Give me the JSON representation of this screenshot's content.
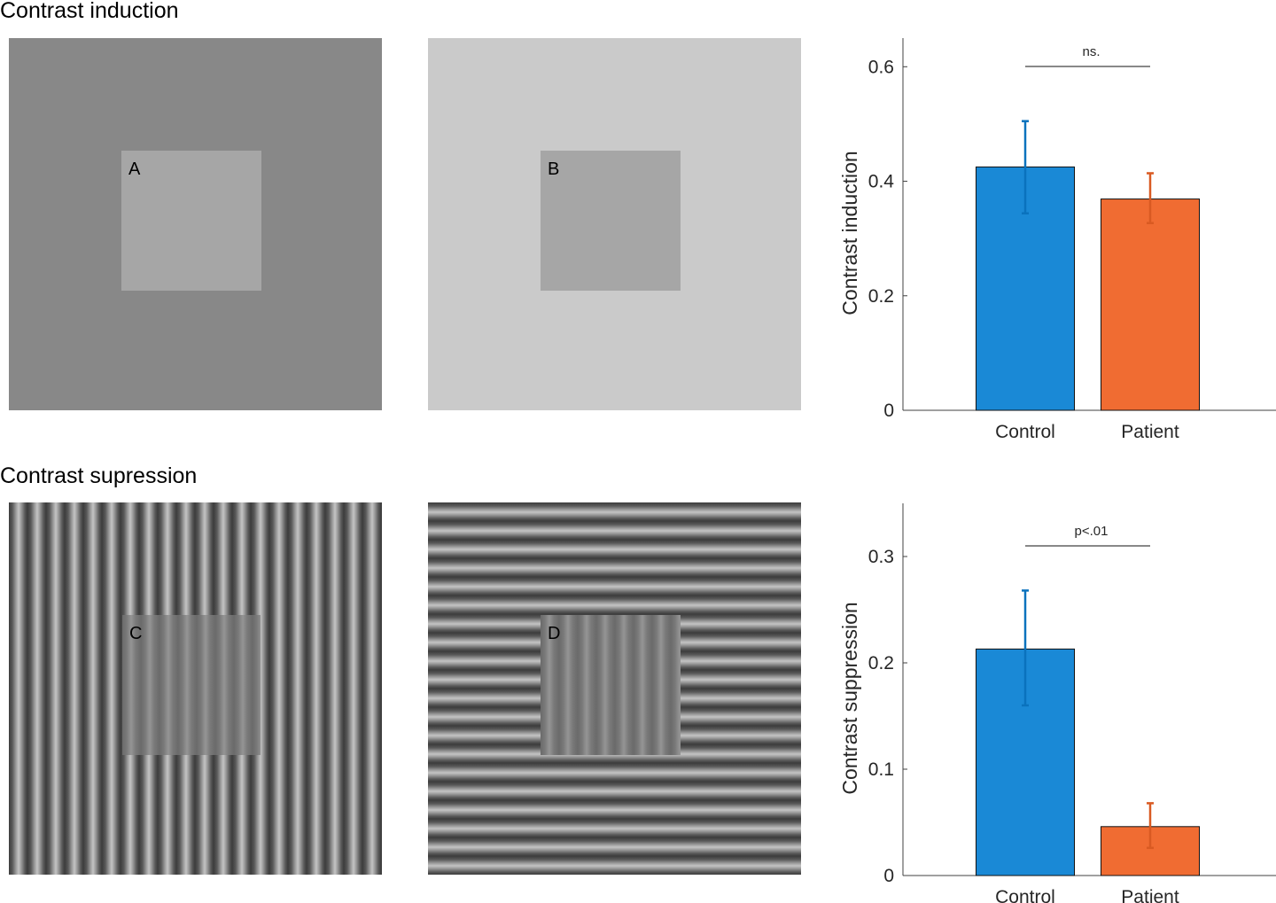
{
  "sections": {
    "induction_title": "Contrast induction",
    "suppression_title": "Contrast supression"
  },
  "stimuli": [
    {
      "label": "A",
      "type": "luminance",
      "surround": "#888888",
      "center": "#a6a6a6"
    },
    {
      "label": "B",
      "type": "luminance",
      "surround": "#cacaca",
      "center": "#a6a6a6"
    },
    {
      "label": "C",
      "type": "grating",
      "surround_orientation": "vertical",
      "center_orientation": "vertical",
      "center_contrast": "low"
    },
    {
      "label": "D",
      "type": "grating",
      "surround_orientation": "horizontal",
      "center_orientation": "vertical",
      "center_contrast": "low"
    }
  ],
  "colors": {
    "control": "#1a89d6",
    "patient": "#f06c32",
    "control_err": "#0a72bd",
    "patient_err": "#d95a22",
    "axis": "#404040"
  },
  "chart_data": [
    {
      "type": "bar",
      "title": "",
      "xlabel": "",
      "ylabel": "Contrast induction",
      "categories": [
        "Control",
        "Patient"
      ],
      "values": [
        0.425,
        0.369
      ],
      "error_low": [
        0.344,
        0.327
      ],
      "error_high": [
        0.505,
        0.414
      ],
      "ylim": [
        0,
        0.65
      ],
      "yticks": [
        0,
        0.2,
        0.4,
        0.6
      ],
      "ytick_labels": [
        "0",
        "0.2",
        "0.4",
        "0.6"
      ],
      "grid": false,
      "significance": {
        "label": "ns.",
        "from": "Control",
        "to": "Patient",
        "y": 0.6
      }
    },
    {
      "type": "bar",
      "title": "",
      "xlabel": "",
      "ylabel": "Contrast suppression",
      "categories": [
        "Control",
        "Patient"
      ],
      "values": [
        0.213,
        0.046
      ],
      "error_low": [
        0.16,
        0.026
      ],
      "error_high": [
        0.268,
        0.068
      ],
      "ylim": [
        0,
        0.35
      ],
      "yticks": [
        0,
        0.1,
        0.2,
        0.3
      ],
      "ytick_labels": [
        "0",
        "0.1",
        "0.2",
        "0.3"
      ],
      "grid": false,
      "significance": {
        "label": "p<.01",
        "from": "Control",
        "to": "Patient",
        "y": 0.31
      }
    }
  ]
}
